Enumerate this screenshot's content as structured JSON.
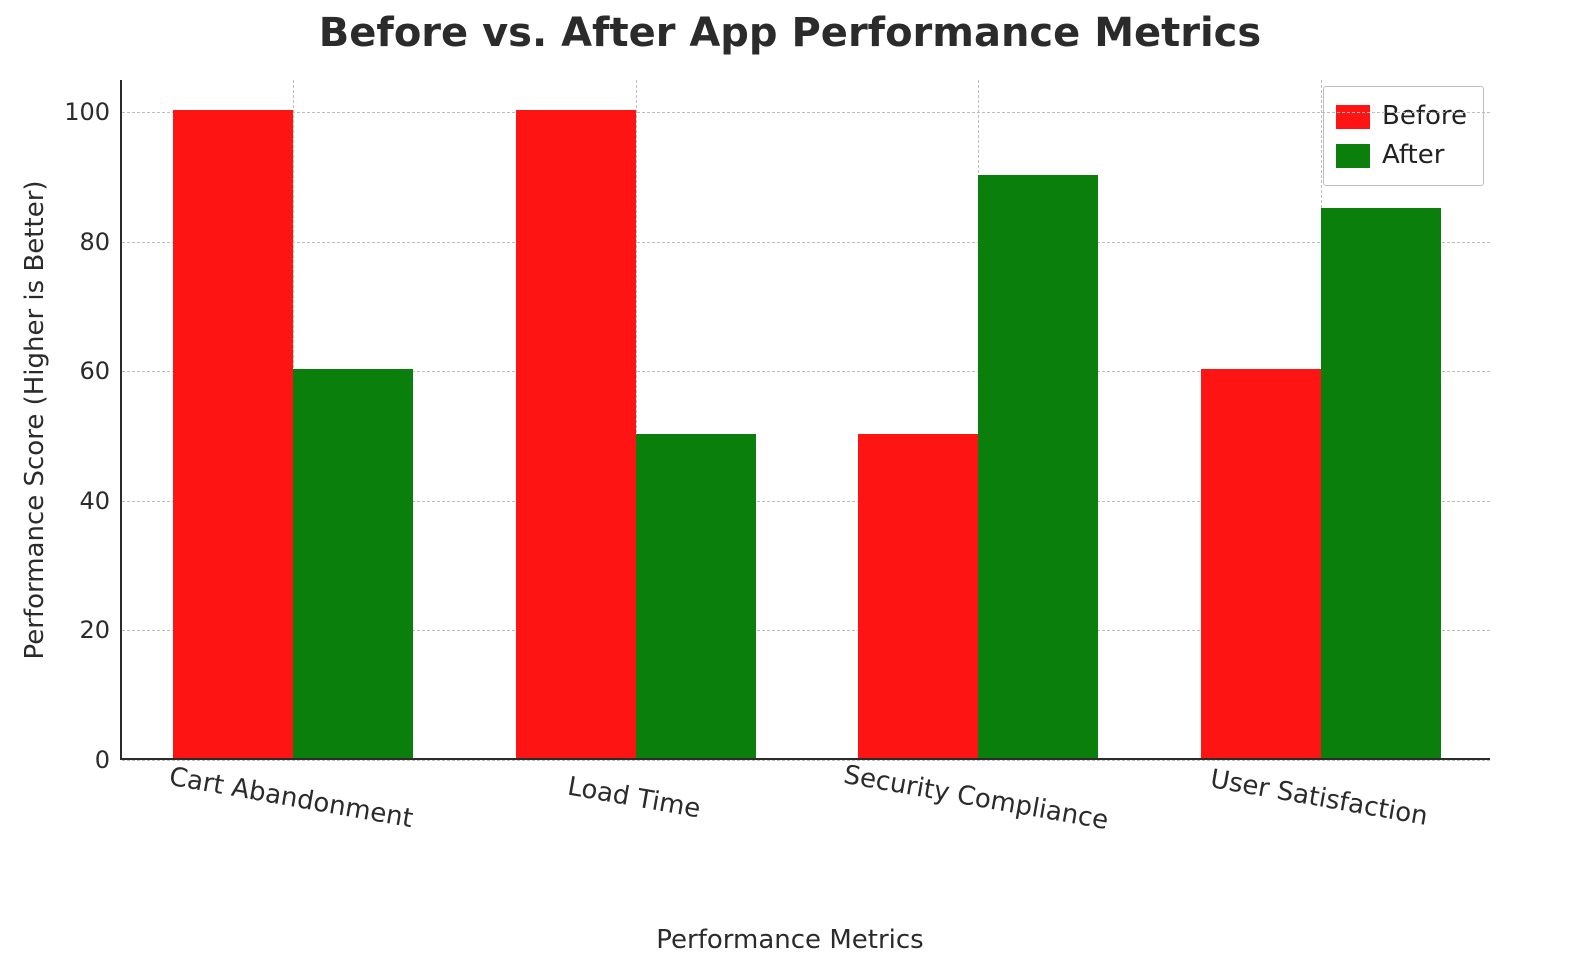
{
  "chart_data": {
    "type": "bar",
    "title": "Before vs. After App Performance Metrics",
    "xlabel": "Performance Metrics",
    "ylabel": "Performance Score (Higher is Better)",
    "categories": [
      "Cart Abandonment",
      "Load Time",
      "Security Compliance",
      "User Satisfaction"
    ],
    "series": [
      {
        "name": "Before",
        "values": [
          100,
          100,
          50,
          60
        ],
        "color": "#ff1414"
      },
      {
        "name": "After",
        "values": [
          60,
          50,
          90,
          85
        ],
        "color": "#0b7f0b"
      }
    ],
    "ylim": [
      0,
      105
    ],
    "yticks": [
      0,
      20,
      40,
      60,
      80,
      100
    ],
    "grid": true,
    "legend_position": "upper-right",
    "legend": {
      "labels": [
        "Before",
        "After"
      ]
    }
  }
}
